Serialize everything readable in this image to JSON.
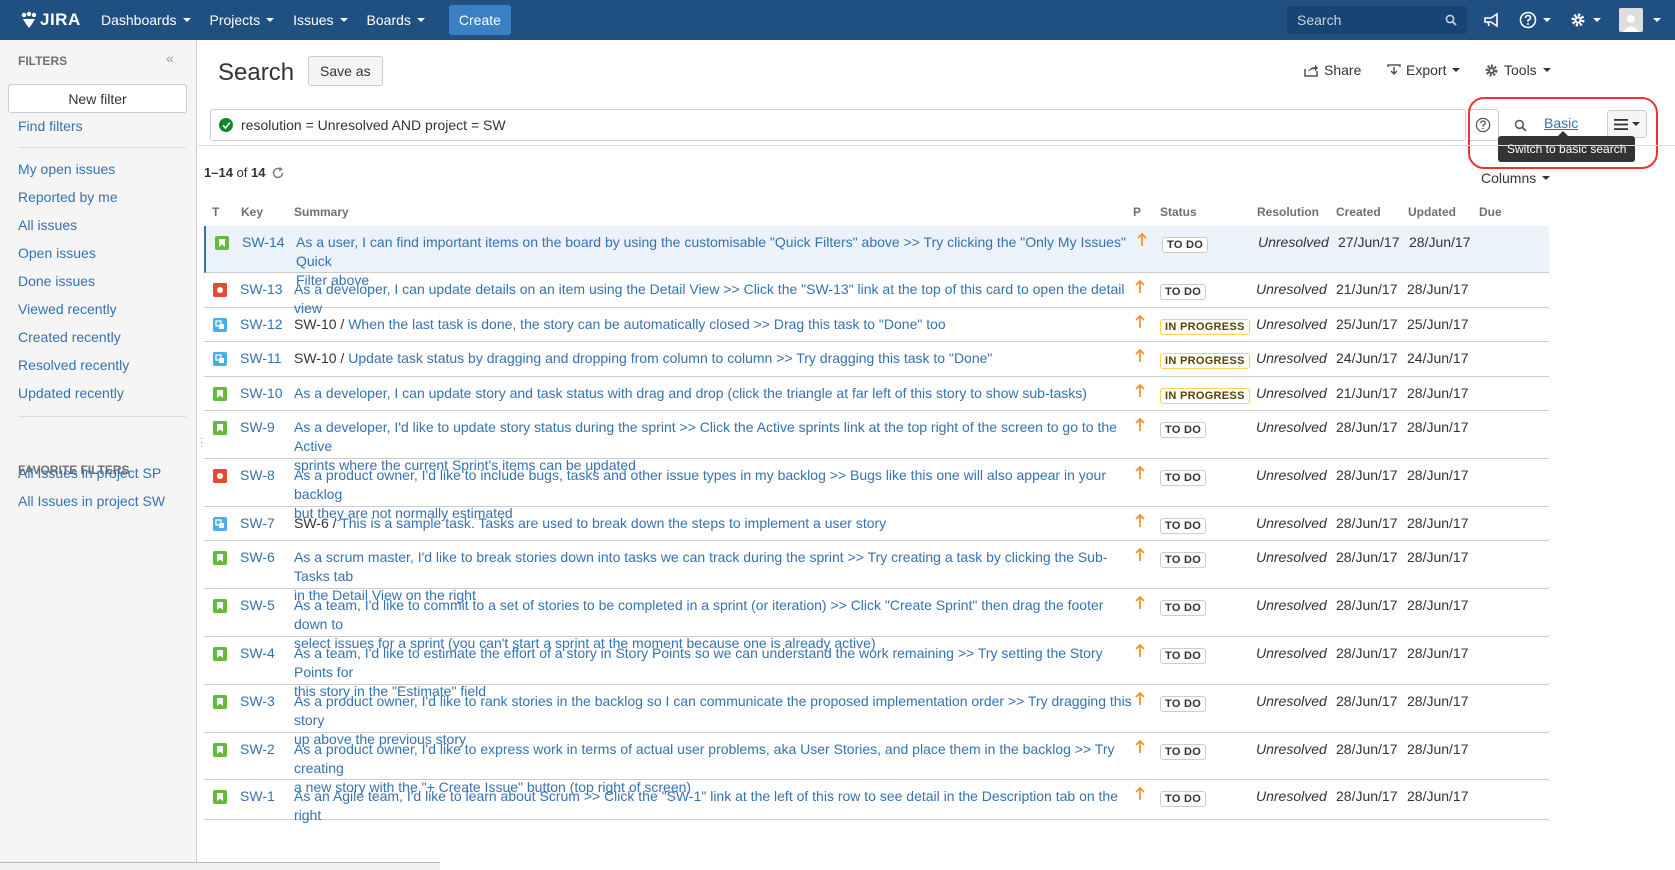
{
  "nav": {
    "logo": "JIRA",
    "items": [
      "Dashboards",
      "Projects",
      "Issues",
      "Boards"
    ],
    "create": "Create",
    "search_placeholder": "Search"
  },
  "sidebar": {
    "heading": "FILTERS",
    "new_filter": "New filter",
    "find_filters": "Find filters",
    "links": [
      "My open issues",
      "Reported by me",
      "All issues",
      "Open issues",
      "Done issues",
      "Viewed recently",
      "Created recently",
      "Resolved recently",
      "Updated recently"
    ],
    "favorites_heading": "FAVORITE FILTERS",
    "favorites": [
      "All Issues in project SP",
      "All Issues in project SW"
    ]
  },
  "header": {
    "title": "Search",
    "save_as": "Save as",
    "share": "Share",
    "export": "Export",
    "tools": "Tools"
  },
  "jql": {
    "query": "resolution = Unresolved AND project = SW",
    "basic": "Basic",
    "tooltip": "Switch to basic search"
  },
  "results": {
    "range": "1–14",
    "of": "of",
    "total": "14",
    "columns_button": "Columns"
  },
  "columns": [
    "T",
    "Key",
    "Summary",
    "P",
    "Status",
    "Resolution",
    "Created",
    "Updated",
    "Due"
  ],
  "issues": [
    {
      "type": "story",
      "key": "SW-14",
      "parent": "",
      "summary1": "As a user, I can find important items on the board by using the customisable \"Quick Filters\" above >> Try clicking the \"Only My Issues\" Quick",
      "summary2": "Filter above",
      "status": "TO DO",
      "resolution": "Unresolved",
      "created": "27/Jun/17",
      "updated": "28/Jun/17"
    },
    {
      "type": "bug",
      "key": "SW-13",
      "parent": "",
      "summary1": "As a developer, I can update details on an item using the Detail View >> Click the \"SW-13\" link at the top of this card to open the detail view",
      "summary2": "",
      "status": "TO DO",
      "resolution": "Unresolved",
      "created": "21/Jun/17",
      "updated": "28/Jun/17"
    },
    {
      "type": "subtask",
      "key": "SW-12",
      "parent": "SW-10 /",
      "summary1": "When the last task is done, the story can be automatically closed >> Drag this task to \"Done\" too",
      "summary2": "",
      "status": "IN PROGRESS",
      "resolution": "Unresolved",
      "created": "25/Jun/17",
      "updated": "25/Jun/17"
    },
    {
      "type": "subtask",
      "key": "SW-11",
      "parent": "SW-10 /",
      "summary1": "Update task status by dragging and dropping from column to column >> Try dragging this task to \"Done\"",
      "summary2": "",
      "status": "IN PROGRESS",
      "resolution": "Unresolved",
      "created": "24/Jun/17",
      "updated": "24/Jun/17"
    },
    {
      "type": "story",
      "key": "SW-10",
      "parent": "",
      "summary1": "As a developer, I can update story and task status with drag and drop (click the triangle at far left of this story to show sub-tasks)",
      "summary2": "",
      "status": "IN PROGRESS",
      "resolution": "Unresolved",
      "created": "21/Jun/17",
      "updated": "28/Jun/17"
    },
    {
      "type": "story",
      "key": "SW-9",
      "parent": "",
      "summary1": "As a developer, I'd like to update story status during the sprint >> Click the Active sprints link at the top right of the screen to go to the Active",
      "summary2": "sprints where the current Sprint's items can be updated",
      "status": "TO DO",
      "resolution": "Unresolved",
      "created": "28/Jun/17",
      "updated": "28/Jun/17"
    },
    {
      "type": "bug",
      "key": "SW-8",
      "parent": "",
      "summary1": "As a product owner, I'd like to include bugs, tasks and other issue types in my backlog >> Bugs like this one will also appear in your backlog",
      "summary2": "but they are not normally estimated",
      "status": "TO DO",
      "resolution": "Unresolved",
      "created": "28/Jun/17",
      "updated": "28/Jun/17"
    },
    {
      "type": "subtask",
      "key": "SW-7",
      "parent": "SW-6 /",
      "summary1": "This is a sample task. Tasks are used to break down the steps to implement a user story",
      "summary2": "",
      "status": "TO DO",
      "resolution": "Unresolved",
      "created": "28/Jun/17",
      "updated": "28/Jun/17"
    },
    {
      "type": "story",
      "key": "SW-6",
      "parent": "",
      "summary1": "As a scrum master, I'd like to break stories down into tasks we can track during the sprint >> Try creating a task by clicking the Sub-Tasks tab",
      "summary2": "in the Detail View on the right",
      "status": "TO DO",
      "resolution": "Unresolved",
      "created": "28/Jun/17",
      "updated": "28/Jun/17"
    },
    {
      "type": "story",
      "key": "SW-5",
      "parent": "",
      "summary1": "As a team, I'd like to commit to a set of stories to be completed in a sprint (or iteration) >> Click \"Create Sprint\" then drag the footer down to",
      "summary2": "select issues for a sprint (you can't start a sprint at the moment because one is already active)",
      "status": "TO DO",
      "resolution": "Unresolved",
      "created": "28/Jun/17",
      "updated": "28/Jun/17"
    },
    {
      "type": "story",
      "key": "SW-4",
      "parent": "",
      "summary1": "As a team, I'd like to estimate the effort of a story in Story Points so we can understand the work remaining >> Try setting the Story Points for",
      "summary2": "this story in the \"Estimate\" field",
      "status": "TO DO",
      "resolution": "Unresolved",
      "created": "28/Jun/17",
      "updated": "28/Jun/17"
    },
    {
      "type": "story",
      "key": "SW-3",
      "parent": "",
      "summary1": "As a product owner, I'd like to rank stories in the backlog so I can communicate the proposed implementation order >> Try dragging this story",
      "summary2": "up above the previous story",
      "status": "TO DO",
      "resolution": "Unresolved",
      "created": "28/Jun/17",
      "updated": "28/Jun/17"
    },
    {
      "type": "story",
      "key": "SW-2",
      "parent": "",
      "summary1": "As a product owner, I'd like to express work in terms of actual user problems, aka User Stories, and place them in the backlog >> Try creating",
      "summary2": "a new story with the \"+ Create Issue\" button (top right of screen)",
      "status": "TO DO",
      "resolution": "Unresolved",
      "created": "28/Jun/17",
      "updated": "28/Jun/17"
    },
    {
      "type": "story",
      "key": "SW-1",
      "parent": "",
      "summary1": "As an Agile team, I'd like to learn about Scrum >> Click the \"SW-1\" link at the left of this row to see detail in the Description tab on the right",
      "summary2": "",
      "status": "TO DO",
      "resolution": "Unresolved",
      "created": "28/Jun/17",
      "updated": "28/Jun/17"
    }
  ],
  "colors": {
    "nav_bg": "#205081",
    "link": "#3572b0",
    "story": "#63ba3c",
    "bug": "#e5493a",
    "subtask": "#4bade8",
    "priority": "#f79232"
  }
}
